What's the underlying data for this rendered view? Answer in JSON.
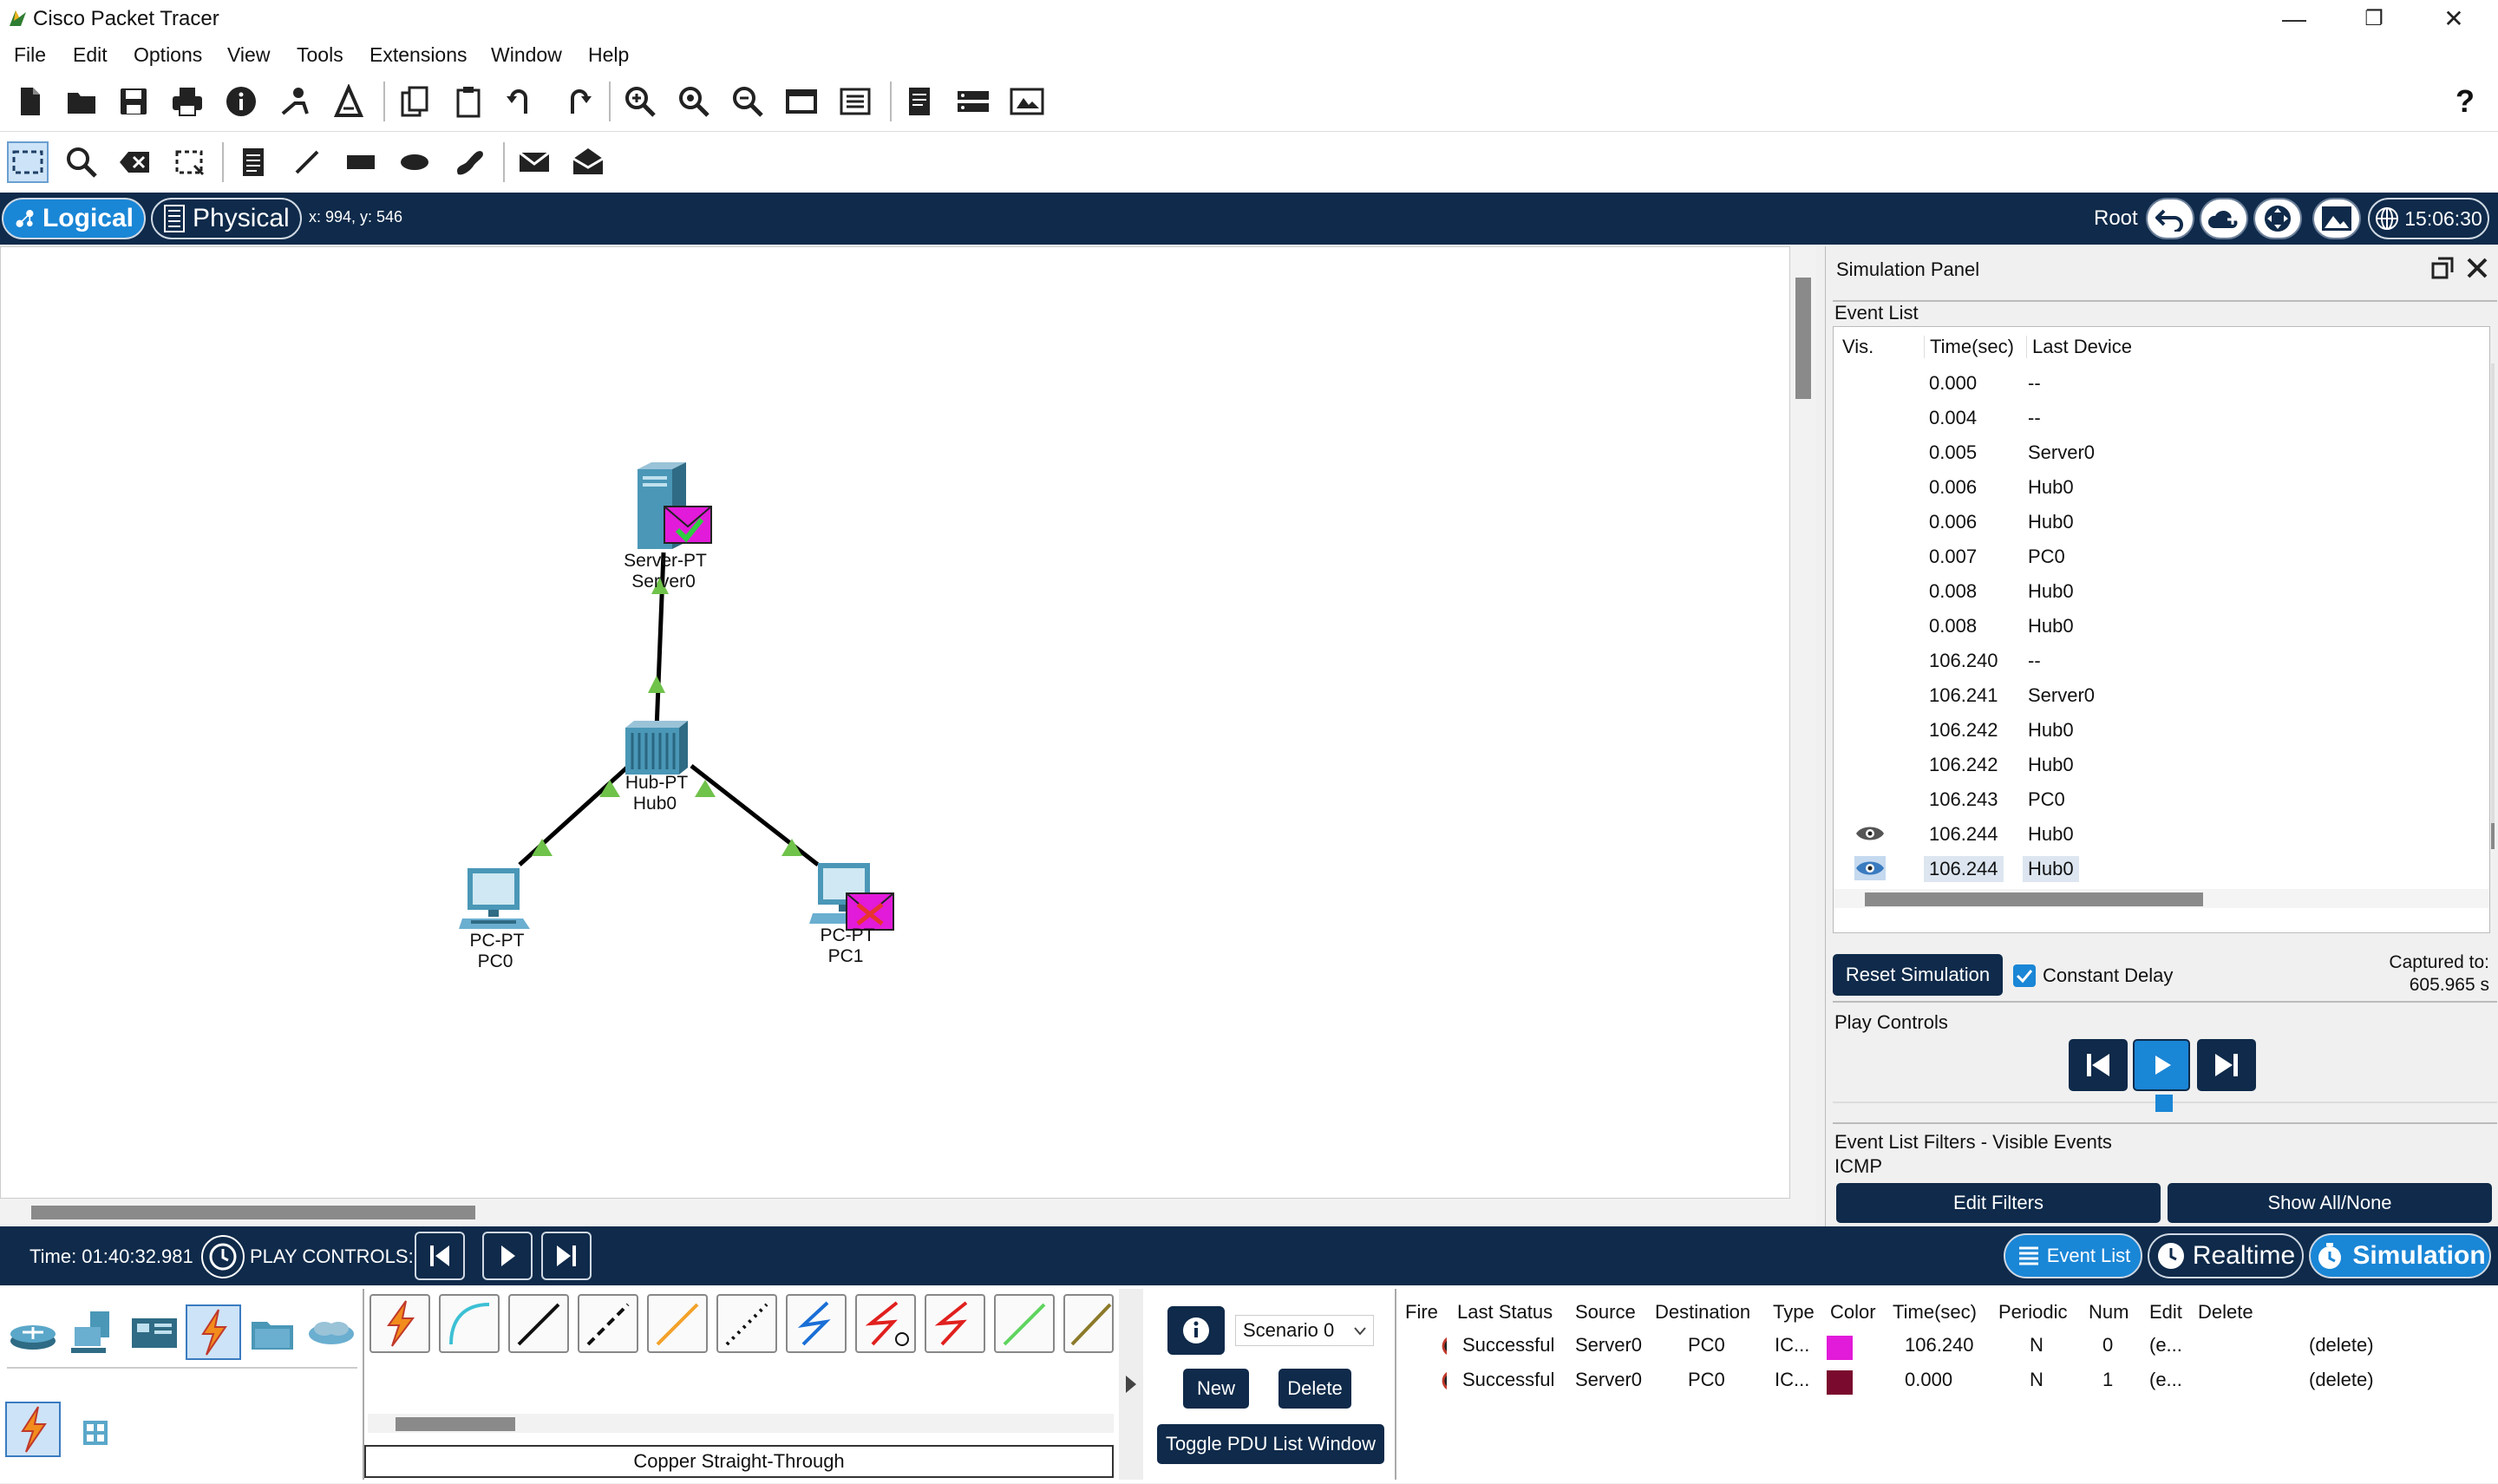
{
  "window": {
    "title": "Cisco Packet Tracer",
    "minimize": "—",
    "maximize": "❐",
    "close": "✕"
  },
  "menu": [
    "File",
    "Edit",
    "Options",
    "View",
    "Tools",
    "Extensions",
    "Window",
    "Help"
  ],
  "toolbar": {
    "help": "?"
  },
  "modebar": {
    "logical": "Logical",
    "physical": "Physical",
    "coords": "x: 994, y: 546",
    "root": "Root",
    "clock": "15:06:30"
  },
  "devices": {
    "server": {
      "type": "Server-PT",
      "name": "Server0"
    },
    "hub": {
      "type": "Hub-PT",
      "name": "Hub0"
    },
    "pc0": {
      "type": "PC-PT",
      "name": "PC0"
    },
    "pc1": {
      "type": "PC-PT",
      "name": "PC1"
    }
  },
  "sim_panel": {
    "title": "Simulation Panel",
    "event_list_label": "Event List",
    "columns": [
      "Vis.",
      "Time(sec)",
      "Last Device"
    ],
    "events": [
      {
        "time": "0.000",
        "device": "--",
        "eye": ""
      },
      {
        "time": "0.004",
        "device": "--",
        "eye": ""
      },
      {
        "time": "0.005",
        "device": "Server0",
        "eye": ""
      },
      {
        "time": "0.006",
        "device": "Hub0",
        "eye": ""
      },
      {
        "time": "0.006",
        "device": "Hub0",
        "eye": ""
      },
      {
        "time": "0.007",
        "device": "PC0",
        "eye": ""
      },
      {
        "time": "0.008",
        "device": "Hub0",
        "eye": ""
      },
      {
        "time": "0.008",
        "device": "Hub0",
        "eye": ""
      },
      {
        "time": "106.240",
        "device": "--",
        "eye": ""
      },
      {
        "time": "106.241",
        "device": "Server0",
        "eye": ""
      },
      {
        "time": "106.242",
        "device": "Hub0",
        "eye": ""
      },
      {
        "time": "106.242",
        "device": "Hub0",
        "eye": ""
      },
      {
        "time": "106.243",
        "device": "PC0",
        "eye": ""
      },
      {
        "time": "106.244",
        "device": "Hub0",
        "eye": "eye-icon"
      },
      {
        "time": "106.244",
        "device": "Hub0",
        "eye": "eye-icon"
      }
    ],
    "reset_simulation": "Reset Simulation",
    "constant_delay": "Constant Delay",
    "captured_label": "Captured to:",
    "captured_value": "605.965 s",
    "play_controls": "Play Controls",
    "filters_label": "Event List Filters - Visible Events",
    "filters_value": "ICMP",
    "edit_filters": "Edit Filters",
    "show_all": "Show All/None"
  },
  "bottombar": {
    "time": "Time: 01:40:32.981",
    "play_controls": "PLAY CONTROLS:",
    "event_list": "Event List",
    "realtime": "Realtime",
    "simulation": "Simulation"
  },
  "cable_label": "Copper Straight-Through",
  "scenario": {
    "selected": "Scenario 0",
    "new": "New",
    "delete": "Delete",
    "toggle": "Toggle PDU List Window"
  },
  "pdu_table": {
    "headers": [
      "Fire",
      "Last Status",
      "Source",
      "Destination",
      "Type",
      "Color",
      "Time(sec)",
      "Periodic",
      "Num",
      "Edit",
      "Delete"
    ],
    "rows": [
      {
        "status": "Successful",
        "source": "Server0",
        "dest": "PC0",
        "type": "IC...",
        "color": "#e21ad9",
        "time": "106.240",
        "periodic": "N",
        "num": "0",
        "edit": "(e...",
        "delete": "(delete)"
      },
      {
        "status": "Successful",
        "source": "Server0",
        "dest": "PC0",
        "type": "IC...",
        "color": "#7a0a2e",
        "time": "0.000",
        "periodic": "N",
        "num": "1",
        "edit": "(e...",
        "delete": "(delete)"
      }
    ]
  },
  "colors": {
    "navy": "#0f2a4a",
    "accent": "#1a86d6",
    "link_green": "#6fc24a",
    "pdu_magenta": "#e21ad9"
  }
}
